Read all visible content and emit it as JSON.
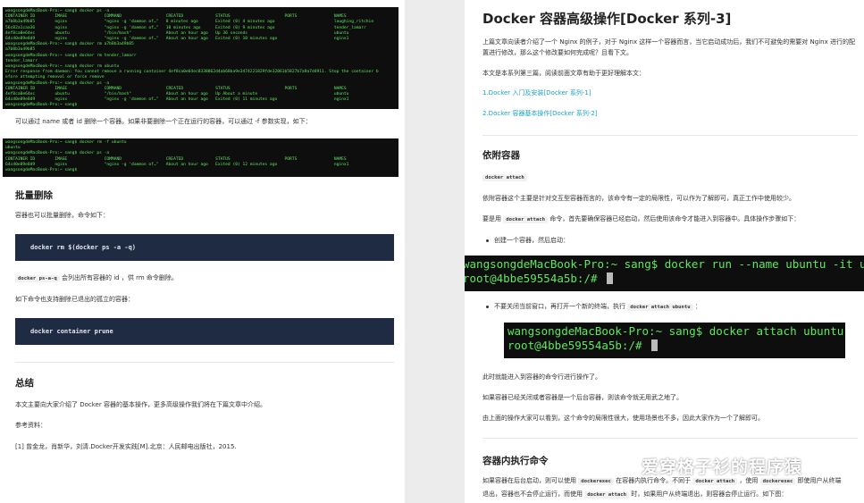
{
  "left": {
    "terminal_top": {
      "lines": [
        "wangsongdeMacBook-Pro:~ sang$ docker ps -a",
        "CONTAINER ID        IMAGE               COMMAND                  CREATED             STATUS                      PORTS               NAMES",
        "a7b8b3a49b85        nginx               \"nginx -g 'daemon of…\"   8 minutes ago       Exited (0) 4 minutes ago                        laughing_ritchie",
        "56c82a1caa36        nginx               \"nginx -g 'daemon of…\"   10 minutes ago      Exited (0) 9 minutes ago                        tender_lamarr",
        "4ef8ca0e64ec        ubuntu              \"/bin/bash\"              About an hour ago   Up 36 seconds                                   ubuntu",
        "64cd0e89e8d9        nginx               \"nginx -g 'daemon of…\"   About an hour ago   Exited (0) 10 minutes ago                       nginx1",
        "wangsongdeMacBook-Pro:~ sang$ docker rm a7b8b3a49b85",
        "a7b8b3a49b85",
        "wangsongdeMacBook-Pro:~ sang$ docker rm tender_lamarr",
        "tender_lamarr",
        "wangsongdeMacBook-Pro:~ sang$ docker rm ubuntu",
        "Error response from daemon: You cannot remove a running container 4ef8ca0e64ec8338862d4ab68ba9e3474221829fde32061b5827b7a9a7d4911. Stop the container b",
        "efore attempting removal or force remove",
        "wangsongdeMacBook-Pro:~ sang$ docker ps -a",
        "CONTAINER ID        IMAGE               COMMAND                  CREATED             STATUS                      PORTS               NAMES",
        "4ef8ca0e64ec        ubuntu              \"/bin/bash\"              About an hour ago   Up About a minute                               ubuntu",
        "64cd0e89e8d9        nginx               \"nginx -g 'daemon of…\"   About an hour ago   Exited (0) 11 minutes ago                       nginx1",
        "wangsongdeMacBook-Pro:~ sang$"
      ]
    },
    "para_remove": "可以通过 name 或者 id 删除一个容器。如果非要删除一个正在运行的容器，可以通过 -f 参数实现，如下：",
    "terminal_mid": {
      "lines": [
        "wangsongdeMacBook-Pro:~ sang$ docker rm -f ubuntu",
        "ubuntu",
        "wangsongdeMacBook-Pro:~ sang$ docker ps -a",
        "CONTAINER ID        IMAGE               COMMAND                  CREATED             STATUS                      PORTS               NAMES",
        "64cd0e89e8d9        nginx               \"nginx -g 'daemon of…\"   About an hour ago   Exited (0) 12 minutes ago                       nginx1",
        "wangsongdeMacBook-Pro:~ sang$"
      ]
    },
    "h_batch": "批量删除",
    "para_batch": "容器也可以批量删除，命令如下：",
    "code_rm_all": "docker rm $(docker ps -a -q)",
    "ps_code": "docker ps-a-q",
    "ps_desc": "会列出所有容器的 id ，供 rm 命令删除。",
    "para_prune": "如下命令也支持删除已退出的孤立的容器：",
    "code_prune": "docker container prune",
    "h_summary": "总结",
    "para_summary": "本文主要向大家介绍了 Docker 容器的基本操作，更多高级操作我们将在下篇文章中介绍。",
    "refs_label": "参考资料：",
    "ref_1": "[1] 曾金龙，肖新华，刘清.Docker开发实践[M].北京：人民邮电出版社，2015."
  },
  "right": {
    "title": "Docker 容器高级操作[Docker 系列-3]",
    "intro": "上篇文章向读者介绍了一个 Nginx 的例子，对于 Nginx 这样一个容器而言，当它启动成功后，我们不可避免的需要对 Nginx 进行的配置进行修改，那么这个修改要如何完成呢？且看下文。",
    "series_intro": "本文是本系列第三篇，阅读前面文章有助于更好理解本文：",
    "link_1": "1.Docker 入门及安装[Docker 系列-1]",
    "link_2": "2.Docker 容器基本操作[Docker 系列-2]",
    "h_attach": "依附容器",
    "attach_cmd": "docker attach",
    "attach_desc": "依附容器这个主要是针对交互型容器而言的，该命令有一定的局限性，可以作为了解即可，真正工作中使用较少。",
    "attach_req_1": "要是用",
    "attach_req_code": "docker attach",
    "attach_req_2": "命令，首先要确保容器已经启动，然后使用该命令才能进入到容器中。具体操作步骤如下：",
    "bullet_1": "创建一个容器，然后启动：",
    "terminal_run": {
      "lines": [
        "wangsongdeMacBook-Pro:~ sang$ docker run --name ubuntu -it ubuntu",
        "root@4bbe59554a5b:/# "
      ]
    },
    "bullet_2_text": "不要关闭当前窗口，再打开一个新的终端，执行",
    "bullet_2_code": "docker attach ubuntu",
    "bullet_2_end": "：",
    "terminal_attach": {
      "lines": [
        "wangsongdeMacBook-Pro:~ sang$ docker attach ubuntu",
        "root@4bbe59554a5b:/# "
      ]
    },
    "para_enter": "此时就能进入到容器的命令行进行操作了。",
    "para_exit": "如果容器已经关闭或者容器是一个后台容器，则该命令就无用武之地了。",
    "para_limit": "由上面的操作大家可以看到，这个命令的局限性很大，使用场景也不多，因此大家作为一个了解即可。",
    "h_exec": "容器内执行命令",
    "exec_1": "如果容器在后台启动，则可以使用",
    "exec_code_1": "dockerexec",
    "exec_2": "在容器内执行命令。不同于",
    "exec_code_2": "docker attach",
    "exec_3": "，使用",
    "exec_code_3": "dockerexec",
    "exec_4": "即使用户从终端",
    "exec_5": "退出，容器也不会停止运行，而使用",
    "exec_code_4": "docker attach",
    "exec_6": "时，如果用户从终端退出，则容器会停止运行。如下图："
  },
  "watermark": {
    "text": "爱穿格子衫的程序猿",
    "icon": "wechat-icon"
  },
  "colors": {
    "terminal_bg": "#0e0e0e",
    "terminal_text": "#5ee85e",
    "code_block_bg": "#1f2b43",
    "link": "#1aa3c8",
    "page_bg": "#ececec"
  }
}
